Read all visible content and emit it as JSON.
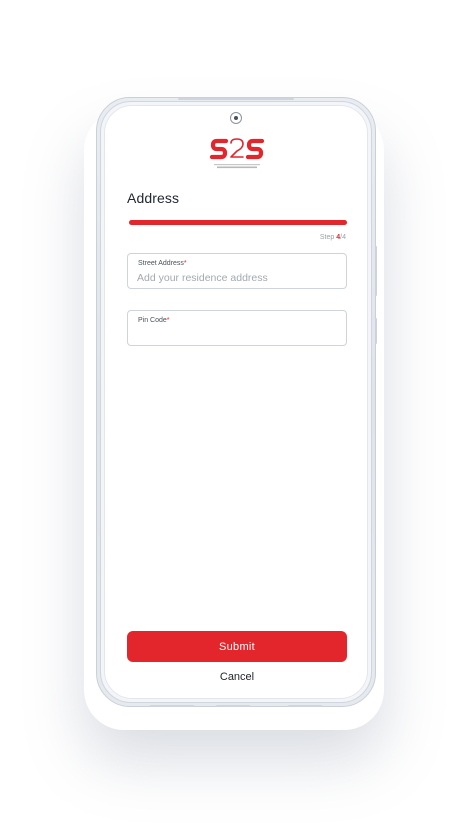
{
  "app": {
    "brand": "S2S",
    "brand_tagline": "S2S GROUP"
  },
  "page": {
    "title": "Address"
  },
  "progress": {
    "current_step": "4",
    "total_steps": "4",
    "fraction": 1.0,
    "step_prefix": "Step ",
    "step_separator": "/"
  },
  "form": {
    "street_address": {
      "label": "Street Address",
      "required_mark": "*",
      "value": "",
      "placeholder": "Add your residence address"
    },
    "pin_code": {
      "label": "Pin Code",
      "required_mark": "*",
      "value": "",
      "placeholder": ""
    }
  },
  "actions": {
    "submit_label": "Submit",
    "cancel_label": "Cancel"
  },
  "colors": {
    "accent": "#e3262b",
    "text_dark": "#222831",
    "muted": "#9aa1a9",
    "progress_track": "#f1d4d4"
  }
}
